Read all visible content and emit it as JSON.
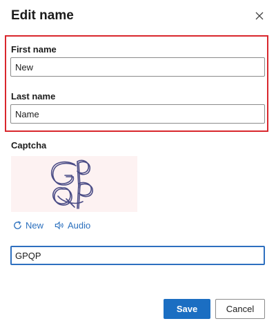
{
  "dialog": {
    "title": "Edit name",
    "close_icon": "close-icon"
  },
  "form": {
    "first_name_label": "First name",
    "first_name_value": "New",
    "last_name_label": "Last name",
    "last_name_value": "Name",
    "captcha_label": "Captcha",
    "captcha_image_text": "GPQP",
    "new_label": "New",
    "audio_label": "Audio",
    "captcha_value": "GPQP"
  },
  "actions": {
    "save_label": "Save",
    "cancel_label": "Cancel"
  },
  "colors": {
    "highlight": "#d9262c",
    "accent": "#1b6ec2",
    "link": "#2a6fbd"
  }
}
